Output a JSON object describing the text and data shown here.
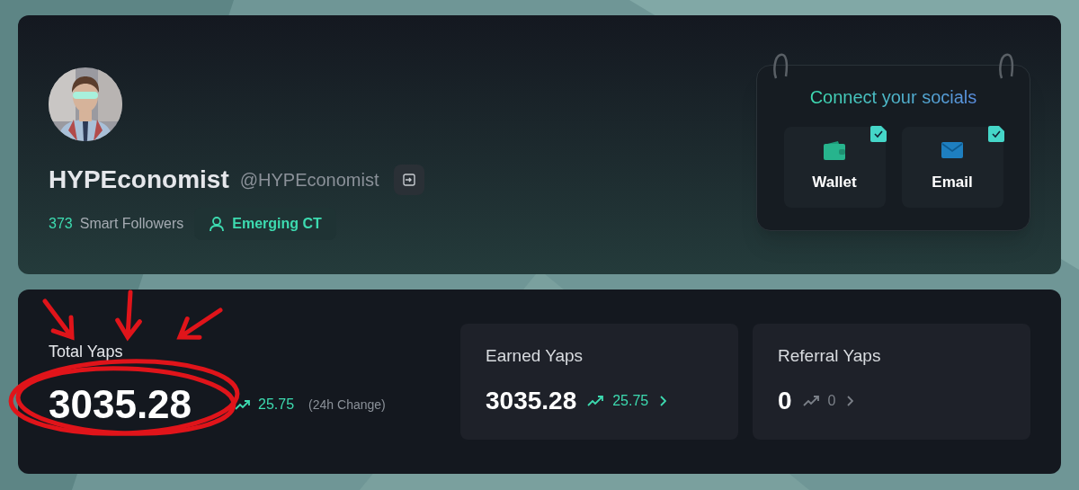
{
  "profile": {
    "display_name": "HYPEconomist",
    "handle": "@HYPEconomist",
    "followers_count": "373",
    "followers_label": "Smart Followers",
    "badge": "Emerging CT"
  },
  "socials": {
    "title": "Connect your socials",
    "items": [
      {
        "kind": "wallet",
        "label": "Wallet",
        "connected": true
      },
      {
        "kind": "email",
        "label": "Email",
        "connected": true
      }
    ]
  },
  "total": {
    "label": "Total Yaps",
    "value": "3035.28",
    "change": "25.75",
    "change_note": "(24h Change)"
  },
  "stat_cards": [
    {
      "label": "Earned Yaps",
      "value": "3035.28",
      "change": "25.75",
      "kind": "positive"
    },
    {
      "label": "Referral Yaps",
      "value": "0",
      "change": "0",
      "kind": "neutral"
    }
  ],
  "markup": [
    {
      "kind": "arrow"
    },
    {
      "kind": "arrow"
    },
    {
      "kind": "arrow"
    },
    {
      "kind": "ellipse"
    }
  ]
}
